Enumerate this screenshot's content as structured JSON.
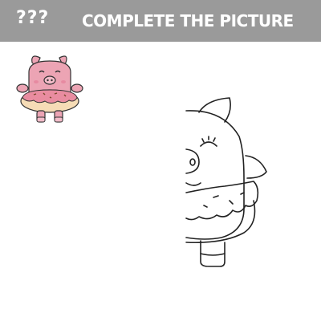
{
  "header": {
    "question_marks": "???",
    "title": "COMPLETE THE PICTURE"
  },
  "colors": {
    "header_bg": "#9a9a9a",
    "pig_pink": "#eca4b4",
    "donut_dough": "#f6dcb6",
    "donut_frosting": "#e98ca0",
    "outline": "#222222"
  },
  "icons": {
    "reference": "pig-with-donut-icon",
    "outline": "half-pig-outline-icon"
  }
}
